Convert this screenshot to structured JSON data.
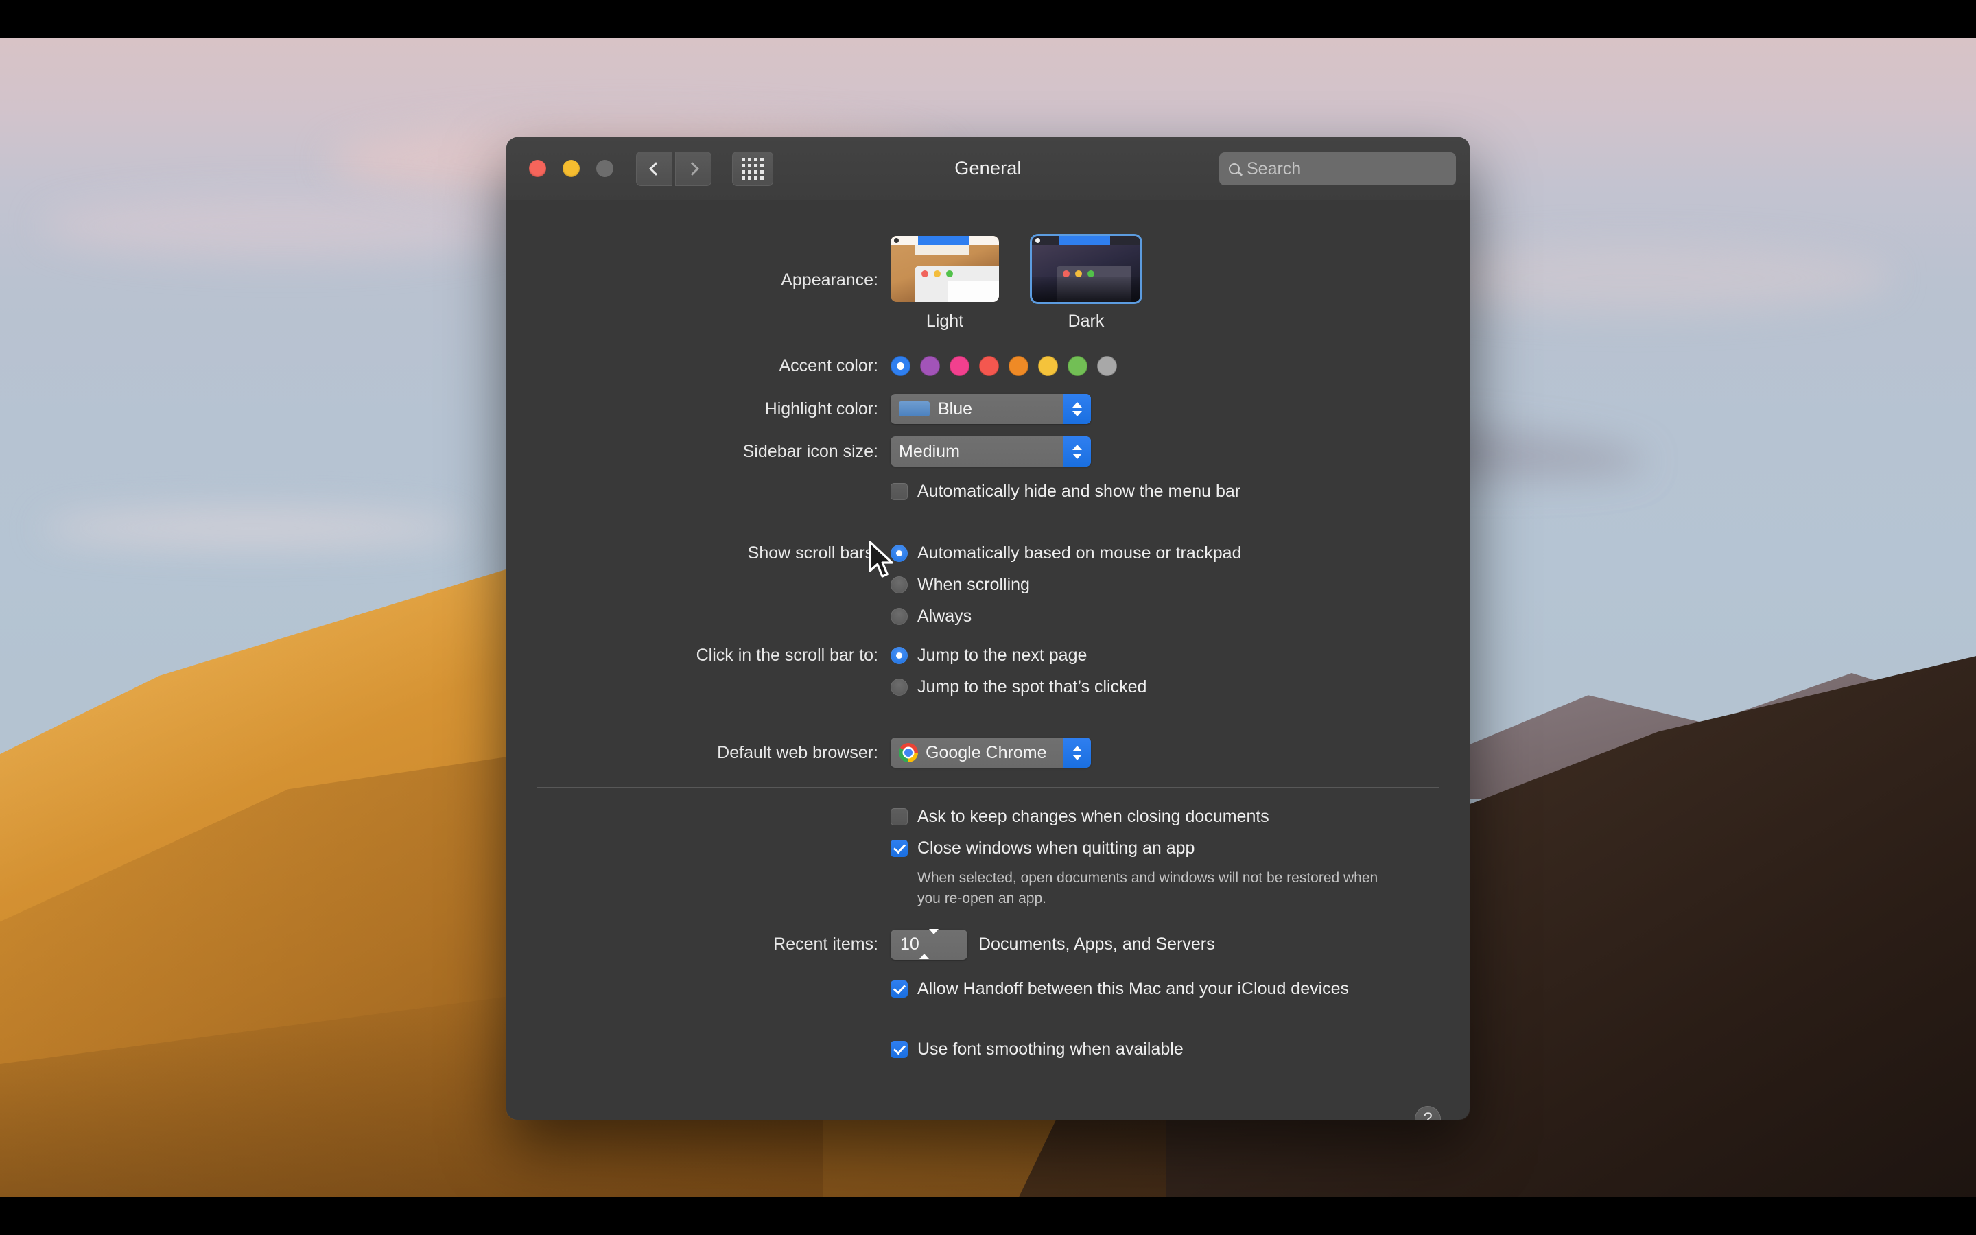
{
  "window": {
    "title": "General",
    "traffic_lights": [
      "close-red",
      "minimize-yellow",
      "zoom-disabled"
    ],
    "nav": {
      "back": "back-chevron",
      "forward": "forward-chevron",
      "grid": "show-all-grid"
    },
    "search": {
      "placeholder": "Search",
      "value": "",
      "icon": "search-icon"
    }
  },
  "appearance": {
    "label": "Appearance:",
    "options": [
      {
        "name": "Light",
        "selected": false
      },
      {
        "name": "Dark",
        "selected": true
      }
    ]
  },
  "accent_color": {
    "label": "Accent color:",
    "selected": "Blue",
    "swatches": [
      {
        "name": "Blue",
        "hex": "#2f7ff0",
        "selected": true
      },
      {
        "name": "Purple",
        "hex": "#a254b8",
        "selected": false
      },
      {
        "name": "Pink",
        "hex": "#f2408e",
        "selected": false
      },
      {
        "name": "Red",
        "hex": "#f4574f",
        "selected": false
      },
      {
        "name": "Orange",
        "hex": "#ef8a26",
        "selected": false
      },
      {
        "name": "Yellow",
        "hex": "#f5c33b",
        "selected": false
      },
      {
        "name": "Green",
        "hex": "#72bf55",
        "selected": false
      },
      {
        "name": "Graphite",
        "hex": "#a8a8a8",
        "selected": false
      }
    ]
  },
  "highlight_color": {
    "label": "Highlight color:",
    "value": "Blue",
    "swatch_hex": "#5b8cc4"
  },
  "sidebar_icon_size": {
    "label": "Sidebar icon size:",
    "value": "Medium"
  },
  "menu_bar": {
    "label": "Automatically hide and show the menu bar",
    "checked": false
  },
  "show_scroll_bars": {
    "label": "Show scroll bars:",
    "options": [
      {
        "label": "Automatically based on mouse or trackpad",
        "selected": true
      },
      {
        "label": "When scrolling",
        "selected": false
      },
      {
        "label": "Always",
        "selected": false
      }
    ]
  },
  "click_scroll_bar": {
    "label": "Click in the scroll bar to:",
    "options": [
      {
        "label": "Jump to the next page",
        "selected": true
      },
      {
        "label": "Jump to the spot that’s clicked",
        "selected": false
      }
    ]
  },
  "default_browser": {
    "label": "Default web browser:",
    "value": "Google Chrome",
    "icon": "chrome-icon"
  },
  "documents": {
    "ask_keep_changes": {
      "label": "Ask to keep changes when closing documents",
      "checked": false
    },
    "close_windows": {
      "label": "Close windows when quitting an app",
      "checked": true
    },
    "note": "When selected, open documents and windows will not be restored when you re-open an app."
  },
  "recent_items": {
    "label": "Recent items:",
    "value": "10",
    "suffix": "Documents, Apps, and Servers"
  },
  "handoff": {
    "label": "Allow Handoff between this Mac and your iCloud devices",
    "checked": true
  },
  "font_smoothing": {
    "label": "Use font smoothing when available",
    "checked": true
  },
  "help": {
    "label": "?"
  }
}
